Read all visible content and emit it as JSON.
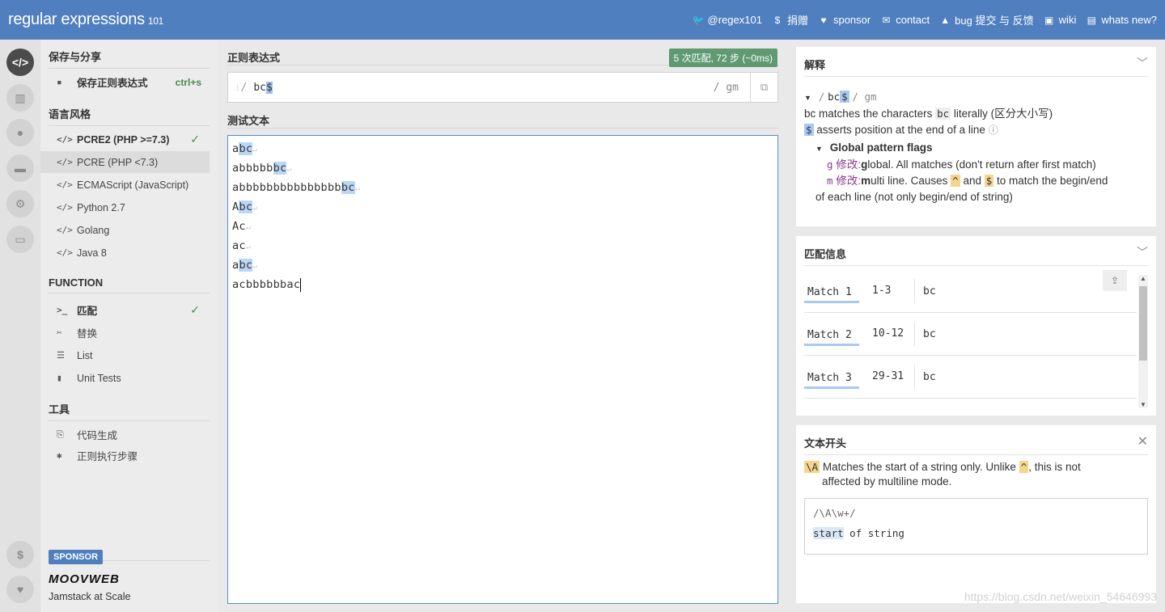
{
  "header": {
    "logo_main": "regular expressions",
    "logo_ver": "101",
    "nav": [
      {
        "icon": "twitter-icon",
        "glyph": "🐦",
        "label": "@regex101"
      },
      {
        "icon": "dollar-icon",
        "glyph": "$",
        "label": "捐赠"
      },
      {
        "icon": "heart-icon",
        "glyph": "♥",
        "label": "sponsor"
      },
      {
        "icon": "mail-icon",
        "glyph": "✉",
        "label": "contact"
      },
      {
        "icon": "warning-icon",
        "glyph": "▲",
        "label": "bug 提交 与 反馈"
      },
      {
        "icon": "chat-icon",
        "glyph": "▣",
        "label": "wiki"
      },
      {
        "icon": "news-icon",
        "glyph": "▤",
        "label": "whats new?"
      }
    ]
  },
  "sidebar": {
    "save_title": "保存与分享",
    "save_item": "保存正则表达式",
    "save_shortcut": "ctrl+s",
    "flavor_title": "语言风格",
    "flavors": [
      {
        "label": "PCRE2 (PHP >=7.3)",
        "checked": true
      },
      {
        "label": "PCRE (PHP <7.3)"
      },
      {
        "label": "ECMAScript (JavaScript)"
      },
      {
        "label": "Python 2.7"
      },
      {
        "label": "Golang"
      },
      {
        "label": "Java 8"
      }
    ],
    "function_title": "FUNCTION",
    "functions": [
      {
        "icon": ">_",
        "label": "匹配",
        "checked": true
      },
      {
        "icon": "✂",
        "label": "替换"
      },
      {
        "icon": "☰",
        "label": "List"
      },
      {
        "icon": "▮",
        "label": "Unit Tests"
      }
    ],
    "tools_title": "工具",
    "tools": [
      {
        "icon": "⎘",
        "label": "代码生成"
      },
      {
        "icon": "✱",
        "label": "正则执行步骤"
      }
    ],
    "sponsor_badge": "SPONSOR",
    "sponsor_name": "MOOVWEB",
    "sponsor_tagline": "Jamstack at Scale"
  },
  "editor": {
    "regex_label": "正则表达式",
    "match_badge": "5 次匹配, 72 步 (~0ms)",
    "regex_delim_open": "/",
    "regex_literal": "bc",
    "regex_anchor": "$",
    "regex_flags": "/ gm",
    "test_label": "测试文本",
    "test_lines": [
      {
        "pre": "a",
        "match": "bc",
        "post": "",
        "ret": true
      },
      {
        "pre": "abbbbb",
        "match": "bc",
        "post": "",
        "ret": true
      },
      {
        "pre": "abbbbbbbbbbbbbbb",
        "match": "bc",
        "post": "",
        "ret": true
      },
      {
        "pre": "A",
        "match": "bc",
        "post": "",
        "ret": true
      },
      {
        "pre": "Ac",
        "match": "",
        "post": "",
        "ret": true
      },
      {
        "pre": "ac",
        "match": "",
        "post": "",
        "ret": true
      },
      {
        "pre": "a",
        "match": "bc",
        "post": "",
        "ret": true
      },
      {
        "pre": "acbbbbbbac",
        "match": "",
        "post": "",
        "ret": false
      }
    ]
  },
  "explanation": {
    "title": "解释",
    "regex_summary_open": "/",
    "regex_summary_literal": "bc",
    "regex_summary_anchor": "$",
    "regex_summary_flags": "/ gm",
    "line1_token": "bc",
    "line1_pre": "bc matches the characters",
    "line1_post": "literally (区分大小写)",
    "line2_token": "$",
    "line2_text": "asserts position at the end of a line",
    "flags_heading": "Global pattern flags",
    "flag_g_key": "g",
    "flag_g_mod": "修改:",
    "flag_g_bold": "g",
    "flag_g_text": "lobal. All matches (don't return after first match)",
    "flag_m_key": "m",
    "flag_m_mod": "修改:",
    "flag_m_bold": "m",
    "flag_m_text1": "ulti line. Causes",
    "flag_m_caret": "^",
    "flag_m_and": "and",
    "flag_m_dollar": "$",
    "flag_m_text2": "to match the begin/end",
    "flag_m_text3": "of each line (not only begin/end of string)"
  },
  "match_info": {
    "title": "匹配信息",
    "matches": [
      {
        "name": "Match 1",
        "range": "1-3",
        "value": "bc"
      },
      {
        "name": "Match 2",
        "range": "10-12",
        "value": "bc"
      },
      {
        "name": "Match 3",
        "range": "29-31",
        "value": "bc"
      }
    ]
  },
  "quickref": {
    "title": "文本开头",
    "token": "\\A",
    "desc_pre": "Matches the start of a string only. Unlike",
    "desc_token": "^",
    "desc_post": ", this is not",
    "desc_line2": "affected by multiline mode.",
    "example_regex": "/\\A\\w+/",
    "example_match": "start",
    "example_rest": "of string"
  },
  "watermark": "https://blog.csdn.net/weixin_54646993"
}
